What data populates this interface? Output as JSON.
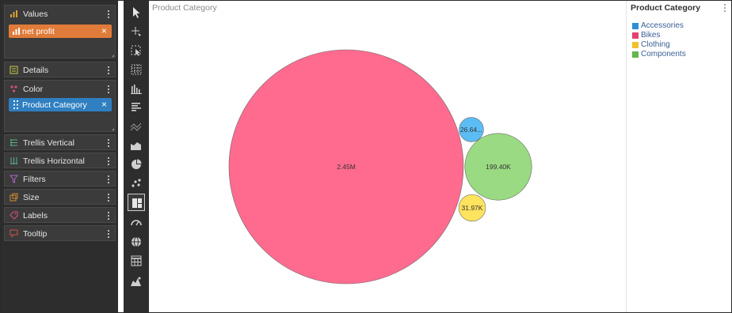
{
  "fields_panel": {
    "wells": [
      {
        "label": "Values",
        "icon": "bar-chart-icon",
        "pills": [
          {
            "label": "net profit",
            "color": "#e07b39"
          }
        ]
      },
      {
        "label": "Details",
        "icon": "details-icon",
        "pills": []
      },
      {
        "label": "Color",
        "icon": "palette-icon",
        "pills": [
          {
            "label": "Product Category",
            "color": "#2f7fc1"
          }
        ]
      },
      {
        "label": "Trellis Vertical",
        "icon": "trellis-vertical-icon",
        "pills": []
      },
      {
        "label": "Trellis Horizontal",
        "icon": "trellis-horizontal-icon",
        "pills": []
      },
      {
        "label": "Filters",
        "icon": "filter-icon",
        "pills": []
      },
      {
        "label": "Size",
        "icon": "size-icon",
        "pills": []
      },
      {
        "label": "Labels",
        "icon": "tag-icon",
        "pills": []
      },
      {
        "label": "Tooltip",
        "icon": "tooltip-icon",
        "pills": []
      }
    ]
  },
  "toolbar": {
    "active": "treemap-icon",
    "tools": [
      "pointer-icon",
      "crosshair-icon",
      "selection-icon",
      "grid-icon",
      "column-chart-icon",
      "bar-chart-icon",
      "line-chart-icon",
      "area-chart-icon",
      "pie-chart-icon",
      "scatter-icon",
      "treemap-icon",
      "gauge-icon",
      "globe-icon",
      "table-icon",
      "map-icon"
    ]
  },
  "chart": {
    "title": "Product Category"
  },
  "legend": {
    "title": "Product Category",
    "items": [
      {
        "label": "Accessories",
        "color": "#2e8fd6"
      },
      {
        "label": "Bikes",
        "color": "#e2436d"
      },
      {
        "label": "Clothing",
        "color": "#f2c12e"
      },
      {
        "label": "Components",
        "color": "#62b64a"
      }
    ]
  },
  "chart_data": {
    "type": "bubble",
    "title": "Product Category",
    "measure": "net profit",
    "color_by": "Product Category",
    "series": [
      {
        "name": "Bikes",
        "value": 2450000,
        "label": "2.45M",
        "color": "#ff6b8f"
      },
      {
        "name": "Components",
        "value": 199400,
        "label": "199.40K",
        "color": "#9ada82"
      },
      {
        "name": "Accessories",
        "value": 26640,
        "label": "26.64...",
        "color": "#5cbdf5"
      },
      {
        "name": "Clothing",
        "value": 31970,
        "label": "31.97K",
        "color": "#fde35e"
      }
    ]
  }
}
